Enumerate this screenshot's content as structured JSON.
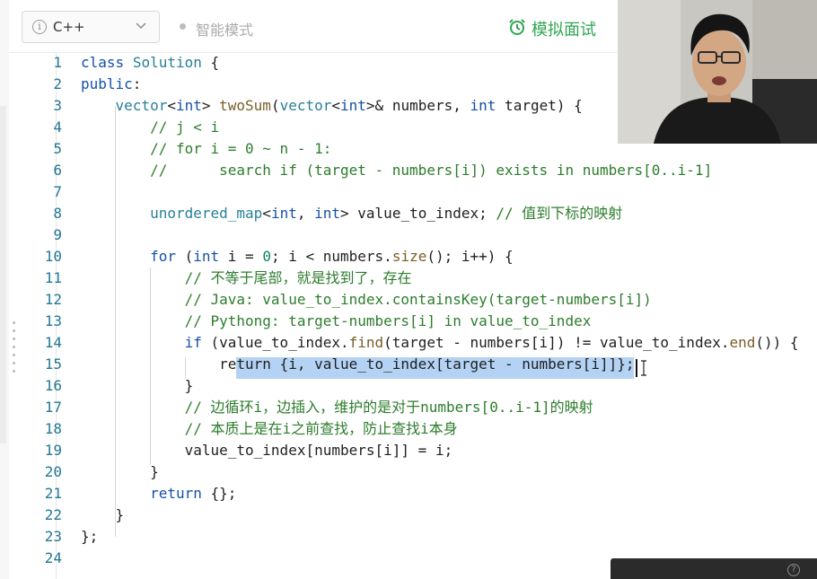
{
  "toolbar": {
    "language": "C++",
    "smart_mode_label": "智能模式",
    "mock_interview_label": "模拟面试"
  },
  "editor": {
    "line_numbers": [
      "1",
      "2",
      "3",
      "4",
      "5",
      "6",
      "7",
      "8",
      "9",
      "10",
      "11",
      "12",
      "13",
      "14",
      "15",
      "16",
      "17",
      "18",
      "19",
      "20",
      "21",
      "22",
      "23",
      "24"
    ],
    "selected_text": "return {i, value_to_index[target - numbers[i]]};"
  },
  "colors": {
    "accent_green": "#2fa552",
    "keyword_blue": "#1550a8",
    "comment_green": "#2d7d2d",
    "selection": "#b3d2f4",
    "line_number": "#237893"
  },
  "icons": [
    "info-icon",
    "chevron-down-icon",
    "alarm-clock-icon",
    "help-icon"
  ]
}
